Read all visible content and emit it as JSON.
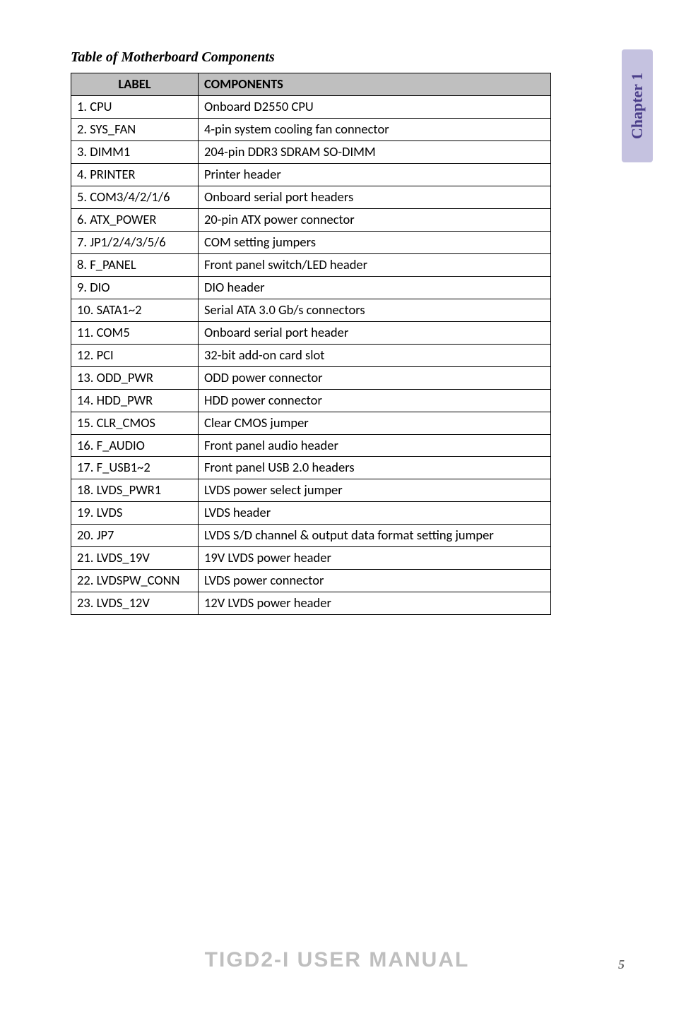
{
  "title": "Table of Motherboard Components",
  "chapter_label": "Chapter 1",
  "headers": {
    "label": "LABEL",
    "components": "COMPONENTS"
  },
  "rows": [
    {
      "label": "1. CPU",
      "component": "Onboard D2550 CPU"
    },
    {
      "label": "2. SYS_FAN",
      "component": "4-pin system cooling fan connector"
    },
    {
      "label": "3. DIMM1",
      "component": "204-pin DDR3 SDRAM SO-DIMM"
    },
    {
      "label": "4. PRINTER",
      "component": "Printer header"
    },
    {
      "label": "5. COM3/4/2/1/6",
      "component": "Onboard serial port headers"
    },
    {
      "label": "6. ATX_POWER",
      "component": "20-pin ATX power connector"
    },
    {
      "label": "7. JP1/2/4/3/5/6",
      "component": "COM setting jumpers"
    },
    {
      "label": "8. F_PANEL",
      "component": "Front panel switch/LED header"
    },
    {
      "label": "9. DIO",
      "component": "DIO header"
    },
    {
      "label": "10. SATA1~2",
      "component": "Serial ATA 3.0 Gb/s connectors"
    },
    {
      "label": "11. COM5",
      "component": "Onboard serial port header"
    },
    {
      "label": "12. PCI",
      "component": "32-bit add-on card slot"
    },
    {
      "label": "13. ODD_PWR",
      "component": "ODD power connector"
    },
    {
      "label": "14. HDD_PWR",
      "component": "HDD power connector"
    },
    {
      "label": "15. CLR_CMOS",
      "component": "Clear CMOS jumper"
    },
    {
      "label": "16. F_AUDIO",
      "component": "Front panel audio header"
    },
    {
      "label": "17. F_USB1~2",
      "component": "Front panel USB 2.0  headers"
    },
    {
      "label": "18. LVDS_PWR1",
      "component": "LVDS power select jumper"
    },
    {
      "label": "19. LVDS",
      "component": "LVDS header"
    },
    {
      "label": "20. JP7",
      "component": "LVDS S/D channel & output data format setting jumper"
    },
    {
      "label": "21. LVDS_19V",
      "component": "19V LVDS power header"
    },
    {
      "label": "22. LVDSPW_CONN",
      "component": "LVDS power connector"
    },
    {
      "label": "23. LVDS_12V",
      "component": "12V LVDS power header"
    }
  ],
  "footer": "TIGD2-I  USER MANUAL",
  "page_number": "5"
}
